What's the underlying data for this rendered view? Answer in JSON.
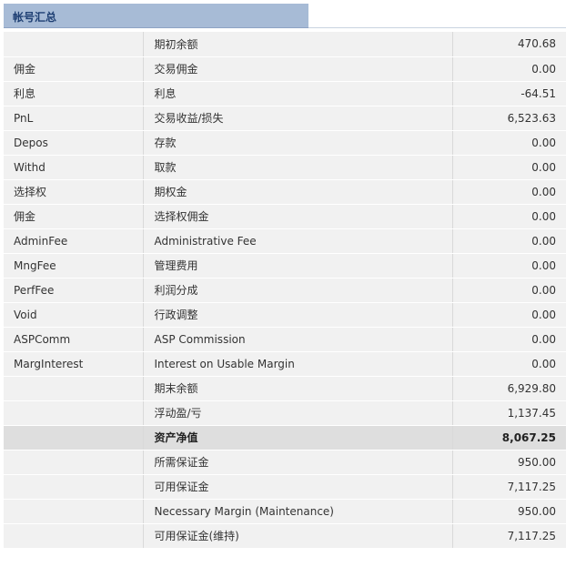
{
  "header": {
    "title": "帐号汇总"
  },
  "table": {
    "rows": [
      {
        "code": "",
        "description": "期初余额",
        "amount": "470.68",
        "total": false
      },
      {
        "code": "佣金",
        "description": "交易佣金",
        "amount": "0.00",
        "total": false
      },
      {
        "code": "利息",
        "description": "利息",
        "amount": "-64.51",
        "total": false
      },
      {
        "code": "PnL",
        "description": "交易收益/损失",
        "amount": "6,523.63",
        "total": false
      },
      {
        "code": "Depos",
        "description": "存款",
        "amount": "0.00",
        "total": false
      },
      {
        "code": "Withd",
        "description": "取款",
        "amount": "0.00",
        "total": false
      },
      {
        "code": "选择权",
        "description": "期权金",
        "amount": "0.00",
        "total": false
      },
      {
        "code": "佣金",
        "description": "选择权佣金",
        "amount": "0.00",
        "total": false
      },
      {
        "code": "AdminFee",
        "description": "Administrative Fee",
        "amount": "0.00",
        "total": false
      },
      {
        "code": "MngFee",
        "description": "管理费用",
        "amount": "0.00",
        "total": false
      },
      {
        "code": "PerfFee",
        "description": "利润分成",
        "amount": "0.00",
        "total": false
      },
      {
        "code": "Void",
        "description": "行政调整",
        "amount": "0.00",
        "total": false
      },
      {
        "code": "ASPComm",
        "description": "ASP Commission",
        "amount": "0.00",
        "total": false
      },
      {
        "code": "MargInterest",
        "description": "Interest on Usable Margin",
        "amount": "0.00",
        "total": false
      },
      {
        "code": "",
        "description": "期末余额",
        "amount": "6,929.80",
        "total": false
      },
      {
        "code": "",
        "description": "浮动盈/亏",
        "amount": "1,137.45",
        "total": false
      },
      {
        "code": "",
        "description": "资产净值",
        "amount": "8,067.25",
        "total": true
      },
      {
        "code": "",
        "description": "所需保证金",
        "amount": "950.00",
        "total": false
      },
      {
        "code": "",
        "description": "可用保证金",
        "amount": "7,117.25",
        "total": false
      },
      {
        "code": "",
        "description": "Necessary Margin (Maintenance)",
        "amount": "950.00",
        "total": false
      },
      {
        "code": "",
        "description": "可用保证金(维持)",
        "amount": "7,117.25",
        "total": false
      }
    ]
  }
}
